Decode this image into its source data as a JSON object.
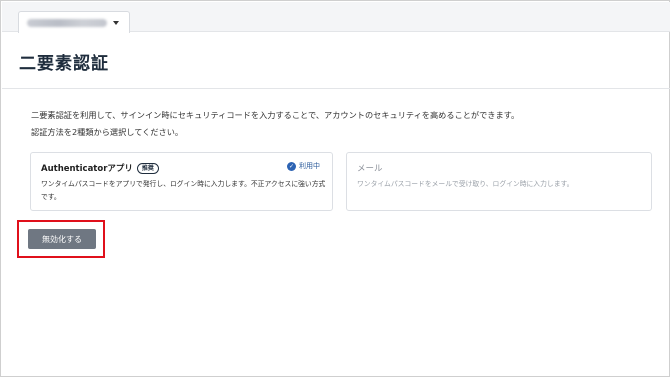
{
  "header": {
    "account_name": "",
    "page_title": "二要素認証"
  },
  "description": {
    "line1": "二要素認証を利用して、サインイン時にセキュリティコードを入力することで、アカウントのセキュリティを高めることができます。",
    "line2": "認証方法を2種類から選択してください。"
  },
  "methods": [
    {
      "title": "Authenticatorアプリ",
      "badge": "推奨",
      "status": "利用中",
      "description": "ワンタイムパスコードをアプリで発行し、ログイン時に入力します。不正アクセスに強い方式です。"
    },
    {
      "title": "メール",
      "description": "ワンタイムパスコードをメールで受け取り、ログイン時に入力します。"
    }
  ],
  "actions": {
    "disable_label": "無効化する"
  },
  "colors": {
    "highlight": "#e0101b",
    "button": "#6f7782",
    "status": "#2d63b3"
  }
}
